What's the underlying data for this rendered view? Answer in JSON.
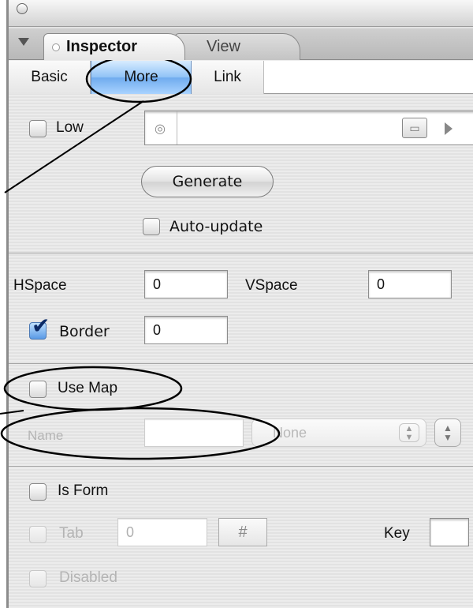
{
  "palette": {
    "panel_bg": "#e6e6e6",
    "selected_tab": "#8fc2f6",
    "text": "#111111",
    "disabled_text": "#b4b4b4",
    "annotation": "#000000"
  },
  "tabs": [
    {
      "label": "Inspector",
      "selected": true
    },
    {
      "label": "View",
      "selected": false
    }
  ],
  "subtabs": [
    {
      "label": "Basic",
      "selected": false
    },
    {
      "label": "More",
      "selected": true
    },
    {
      "label": "Link",
      "selected": false
    }
  ],
  "low_src": {
    "label": "Low",
    "checked": false,
    "value": "",
    "generate_label": "Generate",
    "auto_update_label": "Auto-update",
    "auto_update_checked": false
  },
  "spacing": {
    "hspace_label": "HSpace",
    "hspace_value": "0",
    "vspace_label": "VSpace",
    "vspace_value": "0",
    "border_label": "Border",
    "border_checked": true,
    "border_value": "0"
  },
  "map": {
    "use_map_label": "Use Map",
    "use_map_checked": false,
    "name_label": "Name",
    "name_value": "",
    "popup_value": "None",
    "disabled": true
  },
  "form": {
    "is_form_label": "Is Form",
    "is_form_checked": false,
    "tab_label": "Tab",
    "tab_value": "0",
    "key_label": "Key",
    "key_value": "",
    "disabled_label": "Disabled",
    "disabled_checked": false
  },
  "icons": {
    "disclosure": "disclosure-triangle-icon",
    "target": "target-icon",
    "folder": "folder-icon",
    "arrow": "arrow-right-icon",
    "hash": "hash-icon",
    "stepper": "stepper-icon",
    "checkmark": "checkmark-icon"
  }
}
